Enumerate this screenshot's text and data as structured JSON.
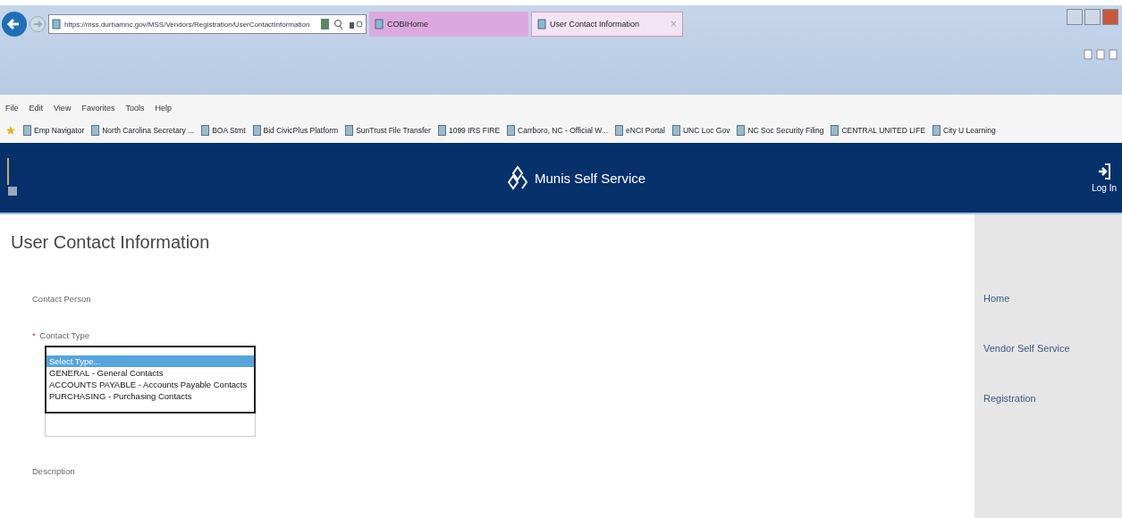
{
  "browser": {
    "url": "https://mss.durhamnc.gov/MSS/Vendors/Registration/UserContactInformation",
    "tabs": [
      {
        "label": "COBIHome",
        "selected": false
      },
      {
        "label": "User Contact Information",
        "selected": true,
        "close": "×"
      }
    ],
    "menu": [
      "File",
      "Edit",
      "View",
      "Favorites",
      "Tools",
      "Help"
    ],
    "favorites": [
      "Emp Navigator",
      "North Carolina Secretary ...",
      "BOA Stmt",
      "Bid CivicPlus Platform",
      "SunTrust File Transfer",
      "1099 IRS FIRE",
      "Carrboro, NC - Official W...",
      "eNCI Portal",
      "UNC Loc Gov",
      "NC Soc Security Filing",
      "CENTRAL UNITED LIFE",
      "City U Learning"
    ]
  },
  "header": {
    "title": "Munis Self Service",
    "login": "Log In"
  },
  "page": {
    "title": "User Contact Information",
    "contact_person_label": "Contact Person",
    "contact_type": {
      "label": "Contact Type",
      "required_mark": "*",
      "options": [
        {
          "label": "Select Type...",
          "selected": true
        },
        {
          "label": "GENERAL - General Contacts",
          "selected": false
        },
        {
          "label": "ACCOUNTS PAYABLE - Accounts Payable Contacts",
          "selected": false
        },
        {
          "label": "PURCHASING - Purchasing Contacts",
          "selected": false
        }
      ]
    },
    "description_label": "Description"
  },
  "sidebar": {
    "items": [
      "Home",
      "Vendor Self Service",
      "Registration"
    ]
  }
}
